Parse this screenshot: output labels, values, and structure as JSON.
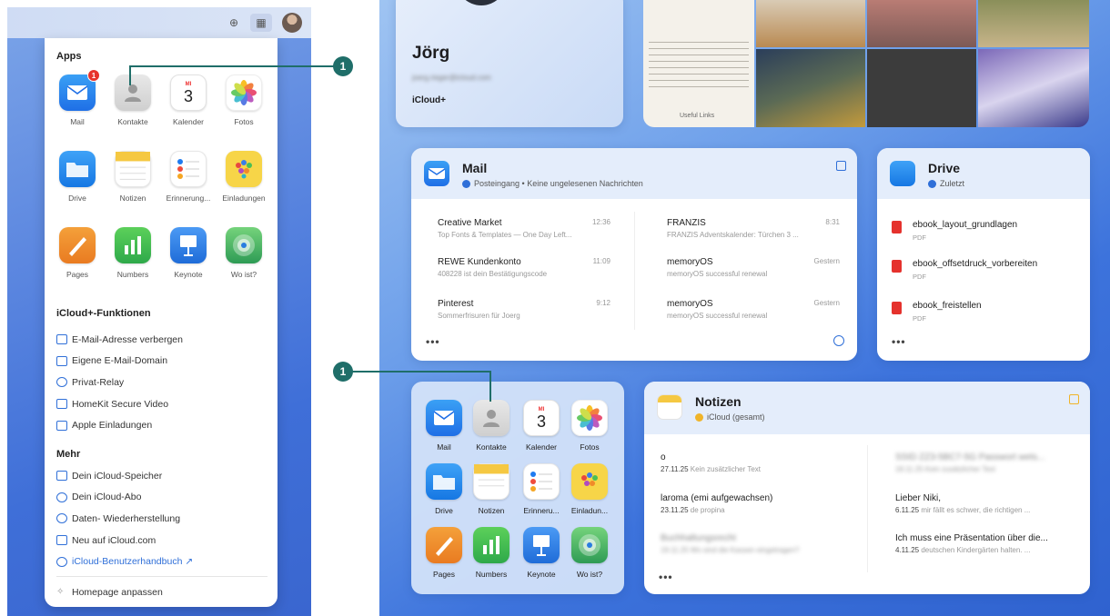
{
  "left": {
    "topbar": {
      "plus_icon": "plus-circle-icon",
      "grid_icon": "app-grid-icon",
      "avatar": "user-avatar"
    },
    "menu": {
      "apps_heading": "Apps",
      "apps": [
        {
          "label": "Mail",
          "badge": "1"
        },
        {
          "label": "Kontakte"
        },
        {
          "label": "Kalender",
          "day": "MI",
          "date": "3"
        },
        {
          "label": "Fotos"
        },
        {
          "label": "Drive"
        },
        {
          "label": "Notizen"
        },
        {
          "label": "Erinnerung..."
        },
        {
          "label": "Einladungen"
        },
        {
          "label": "Pages"
        },
        {
          "label": "Numbers"
        },
        {
          "label": "Keynote"
        },
        {
          "label": "Wo ist?"
        }
      ],
      "functions_heading": "iCloud+-Funktionen",
      "functions": [
        "E-Mail-Adresse verbergen",
        "Eigene E-Mail-Domain",
        "Privat-Relay",
        "HomeKit Secure Video",
        "Apple Einladungen"
      ],
      "more_heading": "Mehr",
      "more": [
        "Dein iCloud-Speicher",
        "Dein iCloud-Abo",
        "Daten- Wiederherstellung",
        "Neu auf iCloud.com",
        "iCloud-Benutzerhandbuch ↗"
      ],
      "customize": "Homepage anpassen"
    },
    "callout": "1"
  },
  "right": {
    "profile": {
      "name": "Jörg",
      "email": "joerg.rieger@icloud.com",
      "plan": "iCloud+"
    },
    "photos_caption": "Useful Links",
    "mail": {
      "title": "Mail",
      "subtitle": "Posteingang • Keine ungelesenen Nachrichten",
      "messages": [
        {
          "from": "Creative Market",
          "time": "12:36",
          "preview": "Top Fonts & Templates — One Day Left..."
        },
        {
          "from": "REWE Kundenkonto",
          "time": "11:09",
          "preview": "408228 ist dein Bestätigungscode"
        },
        {
          "from": "Pinterest",
          "time": "9:12",
          "preview": "Sommerfrisuren für Joerg"
        },
        {
          "from": "FRANZIS",
          "time": "8:31",
          "preview": "FRANZIS Adventskalender: Türchen 3 ..."
        },
        {
          "from": "memoryOS",
          "time": "Gestern",
          "preview": "memoryOS successful renewal"
        },
        {
          "from": "memoryOS",
          "time": "Gestern",
          "preview": "memoryOS successful renewal"
        }
      ],
      "more": "•••"
    },
    "drive": {
      "title": "Drive",
      "subtitle": "Zuletzt",
      "files": [
        {
          "name": "ebook_layout_grundlagen",
          "kind": "PDF"
        },
        {
          "name": "ebook_offsetdruck_vorbereiten",
          "kind": "PDF"
        },
        {
          "name": "ebook_freistellen",
          "kind": "PDF"
        }
      ],
      "more": "•••"
    },
    "apps": [
      "Mail",
      "Kontakte",
      "Kalender",
      "Fotos",
      "Drive",
      "Notizen",
      "Erinneru...",
      "Einladun...",
      "Pages",
      "Numbers",
      "Keynote",
      "Wo ist?"
    ],
    "calendar": {
      "day": "MI",
      "date": "3"
    },
    "notes": {
      "title": "Notizen",
      "subtitle": "iCloud (gesamt)",
      "items": [
        {
          "title": "o",
          "date": "27.11.25",
          "preview": "Kein zusätzlicher Text"
        },
        {
          "title": "laroma (emi aufgewachsen)",
          "date": "23.11.25",
          "preview": "de propina"
        },
        {
          "title": "Buchhaltungsrecht",
          "date": "19.11.25",
          "preview": "Wo sind die Kassen eingetragen?",
          "blurred": true
        },
        {
          "title": "SSID ZZ3-5BC7-5G Passwort wets...",
          "date": "18.11.25",
          "preview": "Kein zusätzlicher Text",
          "blurred": true
        },
        {
          "title": "Lieber Niki,",
          "date": "6.11.25",
          "preview": "mir fällt es schwer, die richtigen ..."
        },
        {
          "title": "Ich muss eine Präsentation über die...",
          "date": "4.11.25",
          "preview": "deutschen Kindergärten halten. ..."
        }
      ],
      "more": "•••"
    },
    "callout": "1"
  }
}
